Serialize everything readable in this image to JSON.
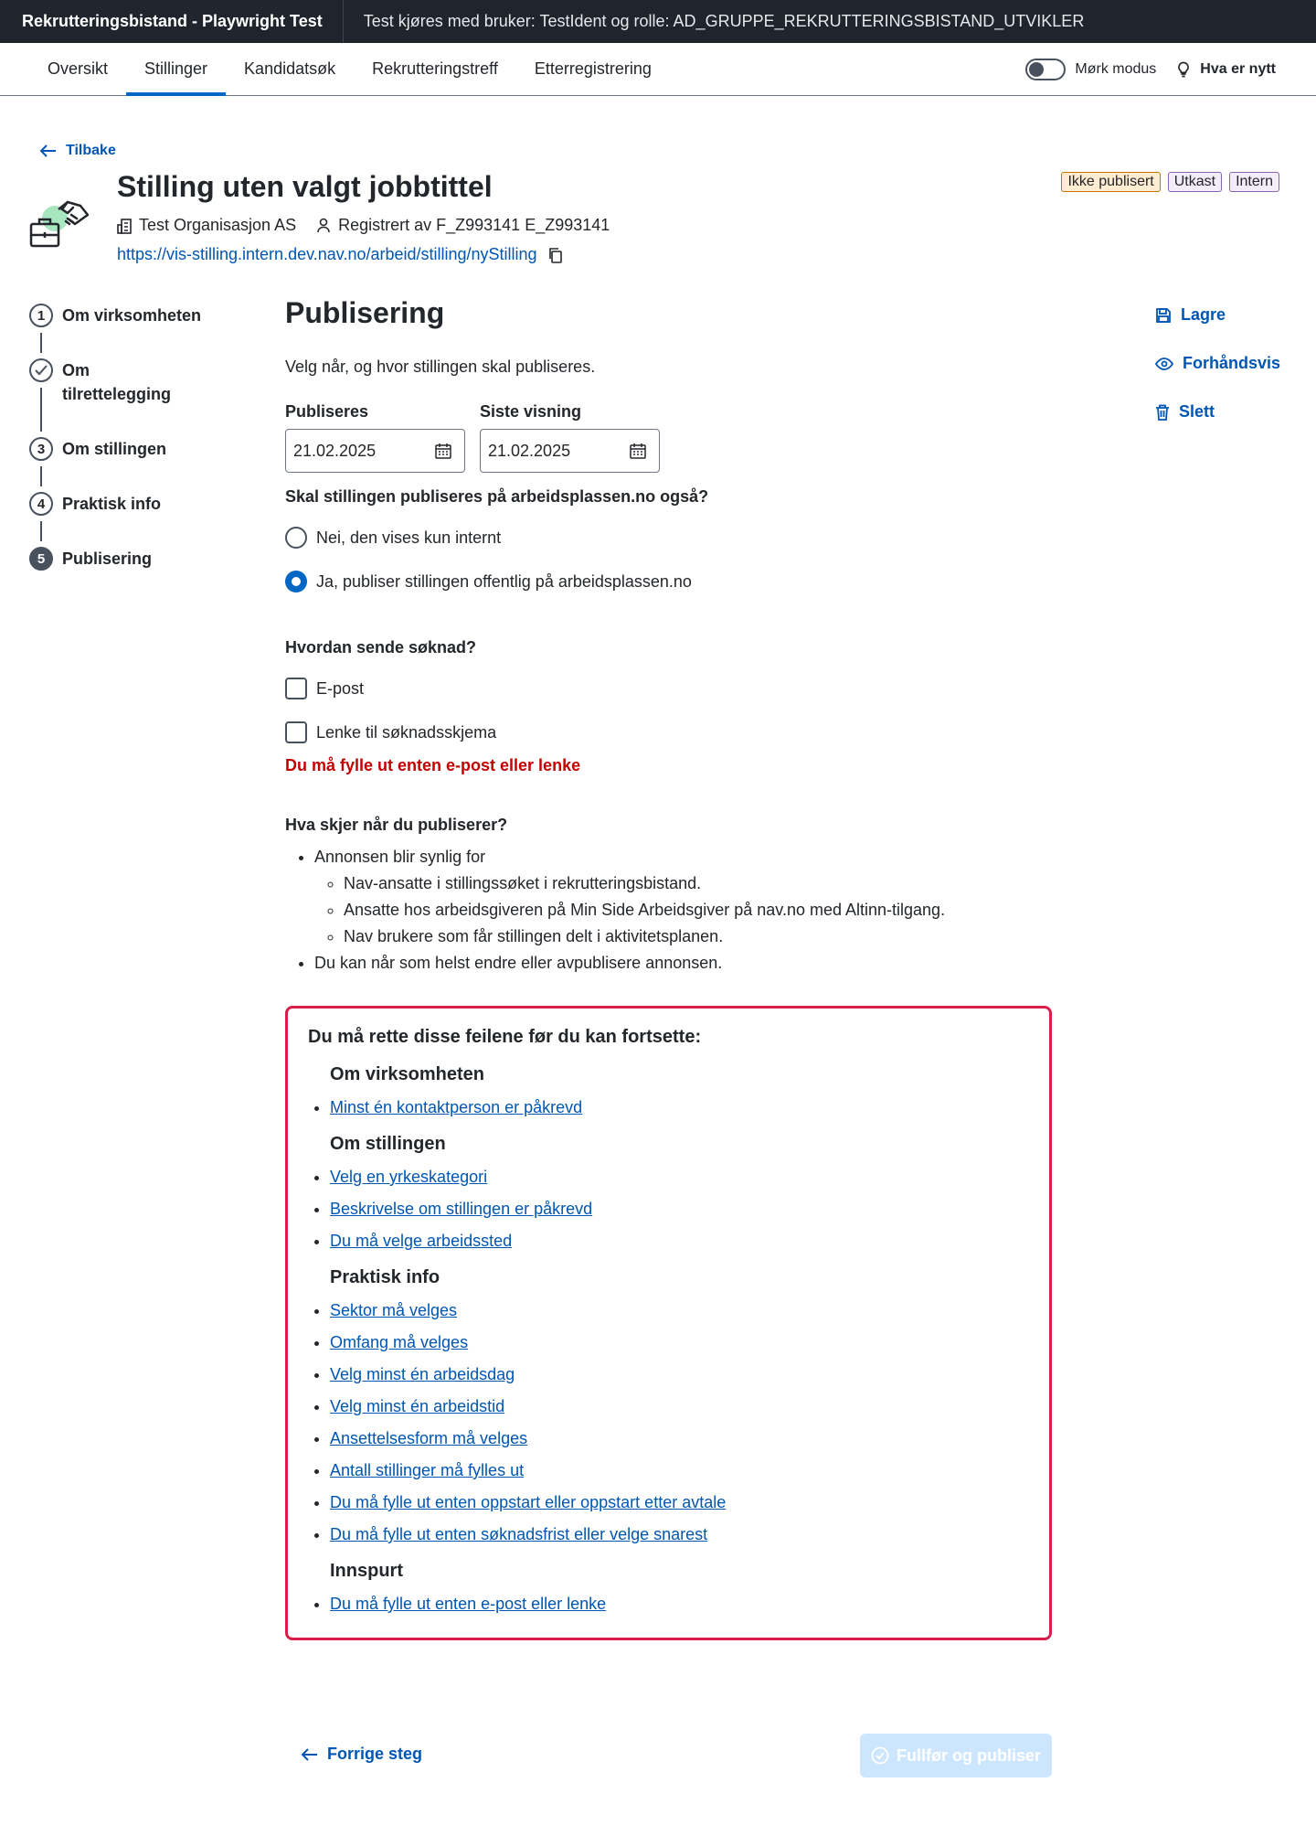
{
  "topbar": {
    "app_title": "Rekrutteringsbistand - Playwright Test",
    "test_info": "Test kjøres med bruker: TestIdent og rolle: AD_GRUPPE_REKRUTTERINGSBISTAND_UTVIKLER"
  },
  "nav": {
    "tabs": [
      "Oversikt",
      "Stillinger",
      "Kandidatsøk",
      "Rekrutteringstreff",
      "Etterregistrering"
    ],
    "active_tab": "Stillinger",
    "dark_mode_label": "Mørk modus",
    "whats_new_label": "Hva er nytt"
  },
  "back_label": "Tilbake",
  "header": {
    "title": "Stilling uten valgt jobbtittel",
    "organisation": "Test Organisasjon AS",
    "registered_by": "Registrert av F_Z993141 E_Z993141",
    "url": "https://vis-stilling.intern.dev.nav.no/arbeid/stilling/nyStilling",
    "tags": [
      "Ikke publisert",
      "Utkast",
      "Intern"
    ]
  },
  "stepper": {
    "steps": [
      {
        "number": "1",
        "label": "Om virksomheten",
        "state": "todo"
      },
      {
        "number": "2",
        "label": "Om tilrettelegging",
        "state": "done"
      },
      {
        "number": "3",
        "label": "Om stillingen",
        "state": "todo"
      },
      {
        "number": "4",
        "label": "Praktisk info",
        "state": "todo"
      },
      {
        "number": "5",
        "label": "Publisering",
        "state": "active"
      }
    ]
  },
  "main": {
    "heading": "Publisering",
    "intro": "Velg når, og hvor stillingen skal publiseres.",
    "publish_label": "Publiseres",
    "publish_value": "21.02.2025",
    "last_view_label": "Siste visning",
    "last_view_value": "21.02.2025",
    "question_public": "Skal stillingen publiseres på arbeidsplassen.no også?",
    "radio_internal": "Nei, den vises kun internt",
    "radio_public": "Ja, publiser stillingen offentlig på arbeidsplassen.no",
    "apply_question": "Hvordan sende søknad?",
    "check_email": "E-post",
    "check_link": "Lenke til søknadsskjema",
    "apply_error": "Du må fylle ut enten e-post eller lenke",
    "what_happens_heading": "Hva skjer når du publiserer?",
    "info_visible": "Annonsen blir synlig for",
    "info_sub": [
      "Nav-ansatte i stillingssøket i rekrutteringsbistand.",
      "Ansatte hos arbeidsgiveren på Min Side Arbeidsgiver på nav.no med Altinn-tilgang.",
      "Nav brukere som får stillingen delt i aktivitetsplanen."
    ],
    "info_change": "Du kan når som helst endre eller avpublisere annonsen."
  },
  "errors": {
    "title": "Du må rette disse feilene før du kan fortsette:",
    "sections": [
      {
        "heading": "Om virksomheten",
        "items": [
          "Minst én kontaktperson er påkrevd"
        ]
      },
      {
        "heading": "Om stillingen",
        "items": [
          "Velg en yrkeskategori",
          "Beskrivelse om stillingen er påkrevd",
          "Du må velge arbeidssted"
        ]
      },
      {
        "heading": "Praktisk info",
        "items": [
          "Sektor må velges",
          "Omfang må velges",
          "Velg minst én arbeidsdag",
          "Velg minst én arbeidstid",
          "Ansettelsesform må velges",
          "Antall stillinger må fylles ut",
          "Du må fylle ut enten oppstart eller oppstart etter avtale",
          "Du må fylle ut enten søknadsfrist eller velge snarest"
        ]
      },
      {
        "heading": "Innspurt",
        "items": [
          "Du må fylle ut enten e-post eller lenke"
        ]
      }
    ]
  },
  "footer": {
    "prev_label": "Forrige steg",
    "finish_label": "Fullfør og publiser"
  },
  "actions": {
    "save": "Lagre",
    "preview": "Forhåndsvis",
    "delete": "Slett"
  },
  "colors": {
    "topbar_bg": "#1f242d",
    "link": "#0056b4",
    "error": "#c30000",
    "error_border": "#d91e4b",
    "accent": "#0067c5",
    "disabled_button": "#cde6ff"
  }
}
